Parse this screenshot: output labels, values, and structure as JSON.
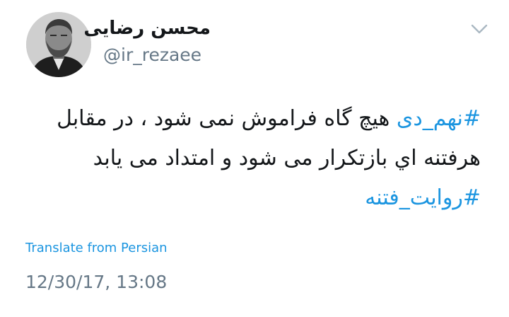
{
  "author": {
    "display_name": "محسن رضایی",
    "handle": "@ir_rezaee",
    "avatar_icon": "profile-photo"
  },
  "menu": {
    "icon": "chevron-down-icon"
  },
  "tweet": {
    "line1": {
      "hashtag": "#نهم_دی",
      "text": " هیچ گاه فراموش نمی شود ، در مقابل"
    },
    "line2": {
      "text": "هرفتنه اي بازتکرار می شود و امتداد می یابد"
    },
    "line3": {
      "hashtag": "#روایت_فتنه"
    }
  },
  "translate_label": "Translate from Persian",
  "timestamp": "12/30/17, 13:08",
  "colors": {
    "link": "#1b95e0",
    "text": "#14171a",
    "secondary": "#657786"
  }
}
